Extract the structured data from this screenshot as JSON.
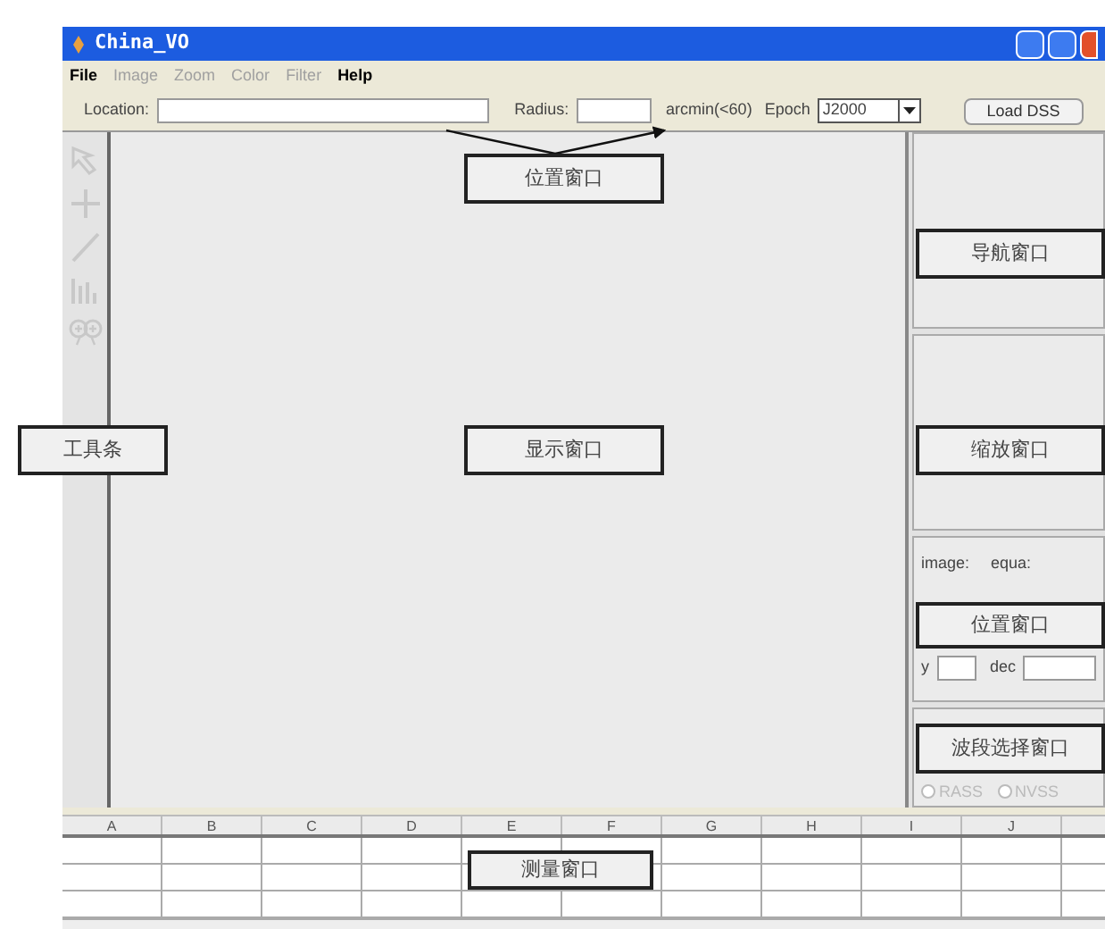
{
  "window": {
    "title": "China_VO"
  },
  "menu": [
    {
      "label": "File",
      "disabled": false
    },
    {
      "label": "Image",
      "disabled": true
    },
    {
      "label": "Zoom",
      "disabled": true
    },
    {
      "label": "Color",
      "disabled": true
    },
    {
      "label": "Filter",
      "disabled": true
    },
    {
      "label": "Help",
      "disabled": false
    }
  ],
  "location_bar": {
    "location_label": "Location:",
    "radius_label": "Radius:",
    "radius_unit": "arcmin(<60)",
    "epoch_label": "Epoch",
    "epoch_value": "J2000",
    "load_button": "Load DSS"
  },
  "position_panel": {
    "image_label": "image:",
    "equa_label": "equa:",
    "y_label": "y",
    "dec_label": "dec"
  },
  "band_panel": {
    "options": [
      {
        "label": "RASS",
        "selected": false
      },
      {
        "label": "NVSS",
        "selected": false
      }
    ]
  },
  "sheet": {
    "columns": [
      "A",
      "B",
      "C",
      "D",
      "E",
      "F",
      "G",
      "H",
      "I",
      "J"
    ]
  },
  "annotations": [
    {
      "text": "位置窗口"
    },
    {
      "text": "导航窗口"
    },
    {
      "text": "工具条"
    },
    {
      "text": "显示窗口"
    },
    {
      "text": "缩放窗口"
    },
    {
      "text": "位置窗口"
    },
    {
      "text": "波段选择窗口"
    },
    {
      "text": "测量窗口"
    }
  ]
}
